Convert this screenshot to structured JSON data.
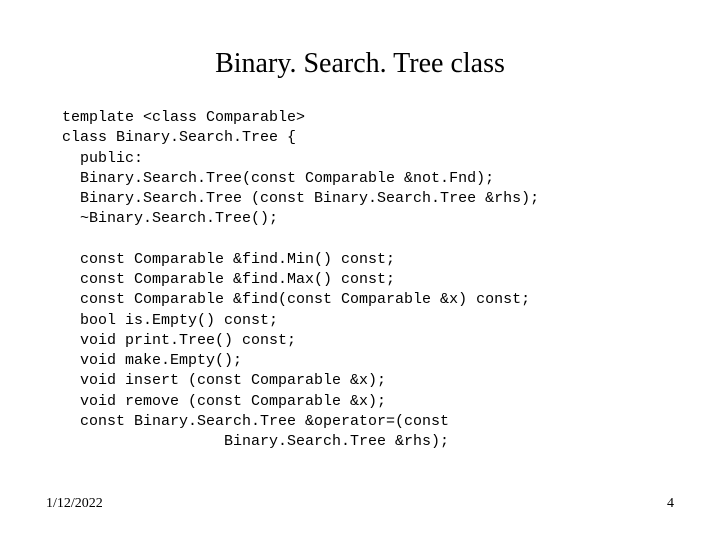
{
  "slide": {
    "title": "Binary. Search. Tree class",
    "code": "template <class Comparable>\nclass Binary.Search.Tree {\n  public:\n  Binary.Search.Tree(const Comparable &not.Fnd);\n  Binary.Search.Tree (const Binary.Search.Tree &rhs);\n  ~Binary.Search.Tree();\n\n  const Comparable &find.Min() const;\n  const Comparable &find.Max() const;\n  const Comparable &find(const Comparable &x) const;\n  bool is.Empty() const;\n  void print.Tree() const;\n  void make.Empty();\n  void insert (const Comparable &x);\n  void remove (const Comparable &x);\n  const Binary.Search.Tree &operator=(const\n                  Binary.Search.Tree &rhs);",
    "date": "1/12/2022",
    "page": "4"
  }
}
